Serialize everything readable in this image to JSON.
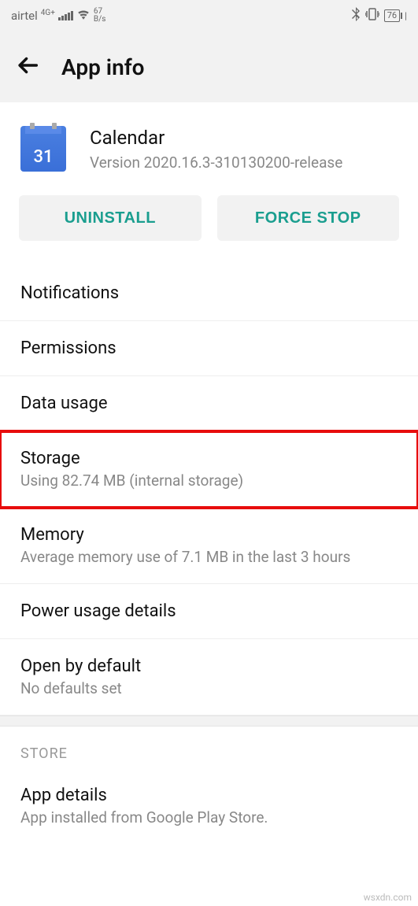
{
  "status": {
    "carrier": "airtel",
    "network_badge": "4G+",
    "speed_value": "67",
    "speed_unit": "B/s",
    "battery": "76"
  },
  "header": {
    "title": "App info"
  },
  "app": {
    "name": "Calendar",
    "icon_day": "31",
    "version_line": "Version 2020.16.3-310130200-release"
  },
  "buttons": {
    "uninstall": "UNINSTALL",
    "force_stop": "FORCE STOP"
  },
  "rows": {
    "notifications": {
      "title": "Notifications"
    },
    "permissions": {
      "title": "Permissions"
    },
    "data_usage": {
      "title": "Data usage"
    },
    "storage": {
      "title": "Storage",
      "sub": "Using 82.74 MB (internal storage)"
    },
    "memory": {
      "title": "Memory",
      "sub": "Average memory use of 7.1 MB in the last 3 hours"
    },
    "power": {
      "title": "Power usage details"
    },
    "open_default": {
      "title": "Open by default",
      "sub": "No defaults set"
    }
  },
  "store": {
    "label": "STORE",
    "app_details": {
      "title": "App details",
      "sub": "App installed from Google Play Store."
    }
  },
  "watermark": "wsxdn.com"
}
